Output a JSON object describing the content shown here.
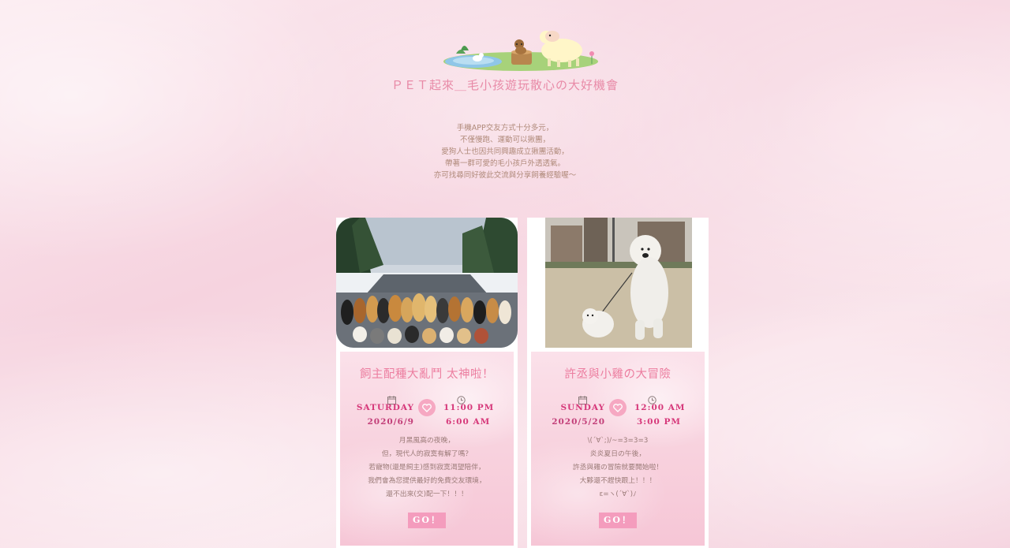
{
  "site": {
    "title": "ＰＥＴ起來＿毛小孩遊玩散心の大好機會"
  },
  "intro": {
    "lines": [
      "手機APP交友方式十分多元，",
      "不僅慢跑、運動可以揪團，",
      "愛狗人士也因共同興趣成立揪團活動，",
      "帶著一群可愛的毛小孩戶外透透氣。",
      "亦可找尋同好彼此交流與分享飼養經驗喔～"
    ]
  },
  "events": [
    {
      "title": "飼主配種大亂鬥 太神啦！",
      "day": "SATURDAY",
      "date": "2020/6/9",
      "time_start": "11:00 PM",
      "time_end": "6:00 AM",
      "desc": [
        "月黑風高の夜晚，",
        "但，現代人的寂寞有解了嗎？",
        "若寵物(還是飼主)感到寂寞渴望陪伴，",
        "我們會為您提供最好的免費交友環境，",
        "還不出來(交)配一下！！！"
      ],
      "button": "GO！"
    },
    {
      "title": "許丞與小雞の大冒險",
      "day": "SUNDAY",
      "date": "2020/5/20",
      "time_start": "12:00 AM",
      "time_end": "3:00 PM",
      "desc": [
        "\\(´∀`;)/~=3=3=3",
        "炎炎夏日の午後，",
        "許丞與雞の冒險就要開始啦！",
        "大夥還不趕快跟上！！！",
        "ε=ヽ(´∀`)ﾉ"
      ],
      "button": "GO！"
    }
  ],
  "colors": {
    "accent_pink": "#ec7ea0",
    "button_pink": "#f49cbd",
    "date_magenta": "#d6387a",
    "body_text": "#9b7b78",
    "intro_text": "#b08a7a"
  },
  "icons": {
    "logo": "farm-animals-logo",
    "calendar": "calendar-icon",
    "clock": "clock-icon",
    "heart": "heart-icon"
  }
}
